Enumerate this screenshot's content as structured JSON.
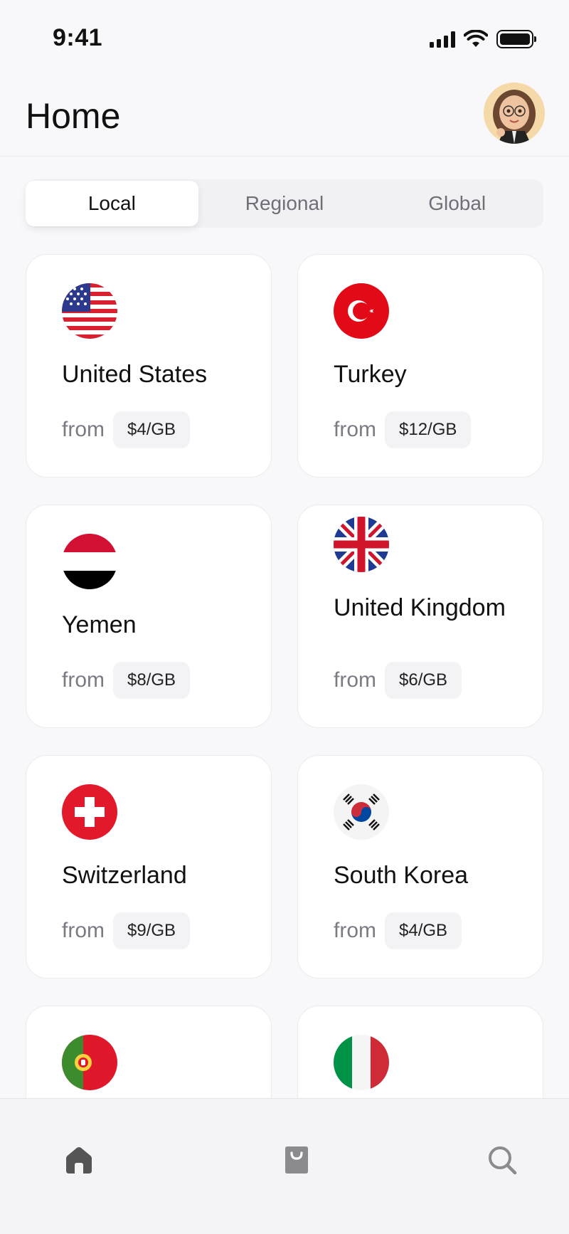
{
  "status_bar": {
    "time": "9:41"
  },
  "header": {
    "title": "Home"
  },
  "tabs": [
    {
      "label": "Local",
      "active": true
    },
    {
      "label": "Regional",
      "active": false
    },
    {
      "label": "Global",
      "active": false
    }
  ],
  "cards": [
    {
      "country": "United States",
      "from_label": "from",
      "price": "$4/GB",
      "flag": "us-flag-icon"
    },
    {
      "country": "Turkey",
      "from_label": "from",
      "price": "$12/GB",
      "flag": "turkey-flag-icon"
    },
    {
      "country": "Yemen",
      "from_label": "from",
      "price": "$8/GB",
      "flag": "yemen-flag-icon"
    },
    {
      "country": "United Kingdom",
      "from_label": "from",
      "price": "$6/GB",
      "flag": "uk-flag-icon"
    },
    {
      "country": "Switzerland",
      "from_label": "from",
      "price": "$9/GB",
      "flag": "switzerland-flag-icon"
    },
    {
      "country": "South Korea",
      "from_label": "from",
      "price": "$4/GB",
      "flag": "south-korea-flag-icon"
    },
    {
      "flag": "portugal-flag-icon"
    },
    {
      "flag": "italy-flag-icon"
    }
  ],
  "bottom_nav": [
    {
      "icon": "home-icon",
      "active": true
    },
    {
      "icon": "shopping-bag-icon",
      "active": false
    },
    {
      "icon": "search-icon",
      "active": false
    }
  ],
  "colors": {
    "background": "#f8f8fa",
    "card": "#ffffff",
    "text_primary": "#111111",
    "text_secondary": "#7b7b84",
    "nav_active": "#555555",
    "nav_inactive": "#8a8a8f"
  }
}
